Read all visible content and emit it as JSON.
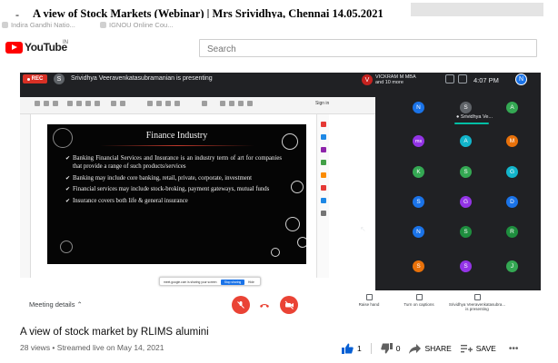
{
  "document": {
    "dash": "-",
    "title": "A view of Stock Markets (Webinar) | Mrs Srividhya, Chennai 14.05.2021"
  },
  "bookmarks": [
    "Indira Gandhi Natio...",
    "IGNOU Online Cou..."
  ],
  "youtube": {
    "logo_text": "YouTube",
    "region": "IN",
    "search_placeholder": "Search"
  },
  "meet": {
    "rec_label": "REC",
    "presenter_initial": "S",
    "presenting_text": "Srividhya Veeravenkatasubramanian is presenting",
    "host_initial": "V",
    "host_name": "VICKRAM M MBA",
    "host_more": "and 10 more",
    "time": "4:07 PM",
    "user_initial": "N",
    "active_speaker_label": "Srividhya Ve...",
    "meeting_details_label": "Meeting details",
    "raise_hand_label": "Raise hand",
    "captions_label": "Turn on captions",
    "presenting_line1": "Srividhya Veeravenkatasubra...",
    "presenting_line2": "is presenting",
    "pdf_signin": "Sign in",
    "share_banner_text": "meet.google.com is sharing your screen",
    "stop_sharing_label": "Stop sharing",
    "hide_label": "Hide",
    "colors": {
      "rec": "#d93025",
      "meet_bg": "#202124",
      "controls_red": "#ea4335",
      "speaking": "#00bfa5"
    },
    "participants": [
      {
        "initial": "N",
        "color": "#1a73e8"
      },
      {
        "initial": "S",
        "color": "#5f6368",
        "speaking": true
      },
      {
        "initial": "A",
        "color": "#34a853"
      },
      {
        "initial": "ms",
        "color": "#9334e6"
      },
      {
        "initial": "A",
        "color": "#12b5cb"
      },
      {
        "initial": "M",
        "color": "#e8710a"
      },
      {
        "initial": "K",
        "color": "#34a853"
      },
      {
        "initial": "S",
        "color": "#34a853"
      },
      {
        "initial": "G",
        "color": "#12b5cb"
      },
      {
        "initial": "S",
        "color": "#1a73e8"
      },
      {
        "initial": "G",
        "color": "#9334e6"
      },
      {
        "initial": "D",
        "color": "#1a73e8"
      },
      {
        "initial": "N",
        "color": "#1a73e8"
      },
      {
        "initial": "S",
        "color": "#1e8e3e"
      },
      {
        "initial": "R",
        "color": "#1e8e3e"
      },
      {
        "initial": "S",
        "color": "#e8710a"
      },
      {
        "initial": "S",
        "color": "#9334e6"
      },
      {
        "initial": "J",
        "color": "#34a853"
      }
    ]
  },
  "slide": {
    "title": "Finance Industry",
    "bullets": [
      "Banking Financial Services and Insurance is an industry term of art for companies that provide a range of such products/services",
      "Banking may include core banking, retail, private, corporate, investment",
      "Financial services may include stock-broking, payment gateways, mutual funds",
      "Insurance covers both life & general insurance"
    ]
  },
  "video": {
    "title": "A view of stock market by RLIMS alumini",
    "meta": "28 views • Streamed live on May 14, 2021",
    "likes": "1",
    "dislikes": "0",
    "share_label": "SHARE",
    "save_label": "SAVE",
    "more_label": "•••"
  }
}
